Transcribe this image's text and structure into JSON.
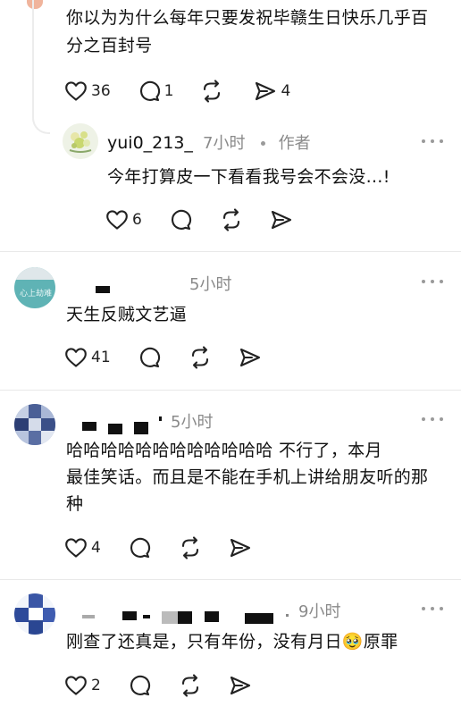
{
  "comment_top": {
    "text_line1": "你以为为什么每年只要发祝毕赣生日快乐几乎百",
    "text_line2": "分之百封号",
    "likes": "36",
    "replies": "1",
    "shares": "4"
  },
  "reply": {
    "username": "yui0_213_",
    "time": "7小时",
    "author_tag": "作者",
    "text": "今年打算皮一下看看我号会不会没…!",
    "likes": "6"
  },
  "comment2": {
    "time": "5小时",
    "avatar_text": "心上劫难",
    "text": "天生反贼文艺逼",
    "likes": "41"
  },
  "comment3": {
    "time": "5小时",
    "text_line1": "哈哈哈哈哈哈哈哈哈哈哈哈 不行了，本月",
    "text_line2": "最佳笑话。而且是不能在手机上讲给朋友听的那",
    "text_line3": "种",
    "likes": "4"
  },
  "comment4": {
    "time": "9小时",
    "text": "刚查了还真是，只有年份，没有月日",
    "emoji": "🥹",
    "text_after": "原罪",
    "likes": "2"
  },
  "icons": {
    "like": "heart-outline-icon",
    "reply": "speech-bubble-icon",
    "repost": "repost-arrows-icon",
    "share": "send-arrow-icon",
    "more": "more-dots-icon"
  }
}
